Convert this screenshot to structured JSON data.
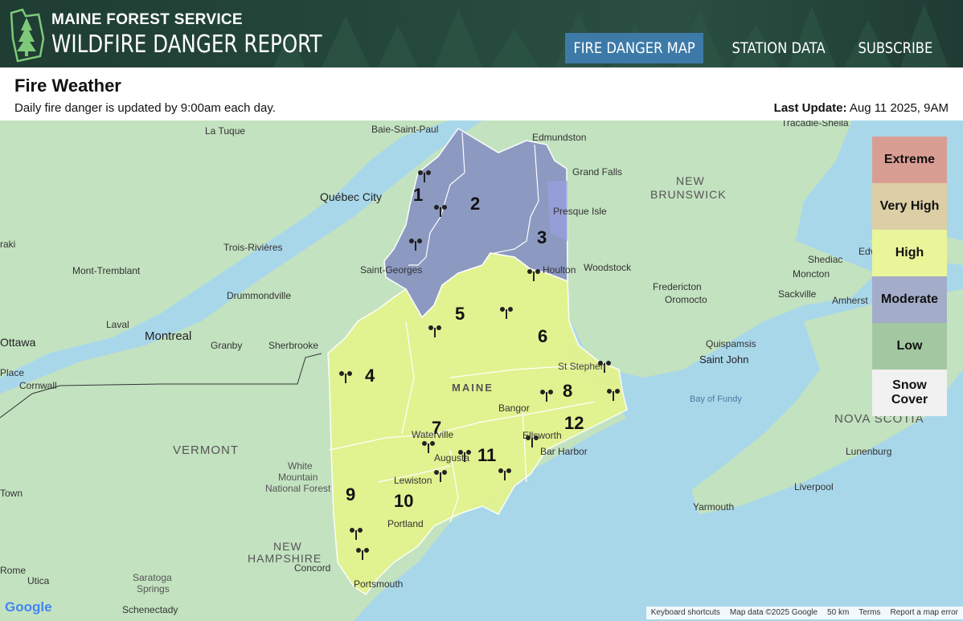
{
  "header": {
    "org": "MAINE FOREST SERVICE",
    "title": "WILDFIRE DANGER REPORT",
    "nav": [
      {
        "label": "FIRE DANGER MAP",
        "active": true
      },
      {
        "label": "STATION DATA",
        "active": false
      },
      {
        "label": "SUBSCRIBE",
        "active": false
      }
    ]
  },
  "page": {
    "title": "Fire Weather",
    "subtitle": "Daily fire danger is updated by 9:00am each day.",
    "last_update_label": "Last Update:",
    "last_update_value": "Aug 11 2025, 9AM"
  },
  "legend": [
    {
      "label": "Extreme",
      "color": "#d99e93"
    },
    {
      "label": "Very High",
      "color": "#dccfa6"
    },
    {
      "label": "High",
      "color": "#eaf59a"
    },
    {
      "label": "Moderate",
      "color": "#a3acc8"
    },
    {
      "label": "Low",
      "color": "#a3c8a1"
    },
    {
      "label": "Snow Cover",
      "color": "#f1f1f1"
    }
  ],
  "zones": [
    {
      "id": "1",
      "danger": "Moderate"
    },
    {
      "id": "2",
      "danger": "Moderate"
    },
    {
      "id": "3",
      "danger": "Moderate"
    },
    {
      "id": "4",
      "danger": "High"
    },
    {
      "id": "5",
      "danger": "High"
    },
    {
      "id": "6",
      "danger": "High"
    },
    {
      "id": "7",
      "danger": "High"
    },
    {
      "id": "8",
      "danger": "High"
    },
    {
      "id": "9",
      "danger": "High"
    },
    {
      "id": "10",
      "danger": "High"
    },
    {
      "id": "11",
      "danger": "High"
    },
    {
      "id": "12",
      "danger": "High"
    }
  ],
  "map_labels": {
    "quebec_city": "Québec City",
    "montreal": "Montreal",
    "trois_rivieres": "Trois-Rivières",
    "sherbrooke": "Sherbrooke",
    "la_tuque": "La Tuque",
    "baie_saint_paul": "Baie-Saint-Paul",
    "edmundston": "Edmundston",
    "grand_falls": "Grand Falls",
    "presque_isle": "Presque Isle",
    "houlton": "Houlton",
    "woodstock": "Woodstock",
    "fredericton": "Fredericton",
    "oromocto": "Oromocto",
    "saint_john": "Saint John",
    "quispamsis": "Quispamsis",
    "moncton": "Moncton",
    "shediac": "Shediac",
    "sackville": "Sackville",
    "amherst": "Amherst",
    "tracadie": "Tracadie-Sheila",
    "new_brunswick": "NEW\nBRUNSWICK",
    "nova_scotia": "NOVA SCOTIA",
    "bay_of_fundy": "Bay of Fundy",
    "lunenburg": "Lunenburg",
    "liverpool": "Liverpool",
    "yarmouth": "Yarmouth",
    "maine": "MAINE",
    "bangor": "Bangor",
    "augusta": "Augusta",
    "waterville": "Waterville",
    "lewiston": "Lewiston",
    "portland": "Portland",
    "ellsworth": "Ellsworth",
    "bar_harbor": "Bar Harbor",
    "st_stephen": "St Stephen",
    "vermont": "VERMONT",
    "new_hampshire": "NEW\nHAMPSHIRE",
    "white_mountain": "White\nMountain\nNational Forest",
    "concord": "Concord",
    "portsmouth": "Portsmouth",
    "rome": "Rome",
    "utica": "Utica",
    "saratoga": "Saratoga\nSprings",
    "schenectady": "Schenectady",
    "ottawa": "Ottawa",
    "laval": "Laval",
    "granby": "Granby",
    "drummondville": "Drummondville",
    "mont_tremblant": "Mont-Tremblant",
    "saint_georges": "Saint-Georges",
    "cornwall": "Cornwall",
    "place": "Place",
    "town": "Town",
    "edv": "Edv",
    "oraki": "raki"
  },
  "footer": {
    "shortcuts": "Keyboard shortcuts",
    "map_data": "Map data ©2025 Google",
    "scale": "50 km",
    "terms": "Terms",
    "report": "Report a map error",
    "google": "Google"
  },
  "colors": {
    "header_bg": "#24473b",
    "nav_active": "#3d7aa8",
    "water": "#a9d7ea",
    "land": "#bfe0c0",
    "moderate": "#8a96c2",
    "high": "#e3f38e"
  }
}
